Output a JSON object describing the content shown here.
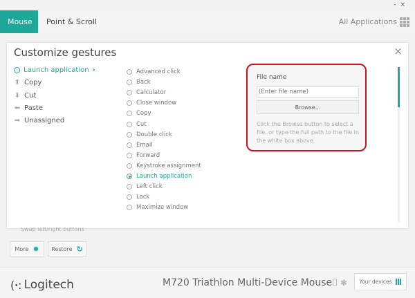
{
  "window": {
    "minimize": "-",
    "close": "×"
  },
  "tabs": [
    {
      "label": "Mouse",
      "active": true
    },
    {
      "label": "Point & Scroll"
    }
  ],
  "all_apps": "All Applications",
  "panel": {
    "title": "Customize gestures",
    "close": "×",
    "gestures": [
      {
        "icon": "circle-icon",
        "glyph": "",
        "label": "Launch application",
        "active": true,
        "chevron": "›"
      },
      {
        "icon": "arrow-up-icon",
        "glyph": "⬆",
        "label": "Copy"
      },
      {
        "icon": "arrow-down-icon",
        "glyph": "⬇",
        "label": "Cut"
      },
      {
        "icon": "arrow-left-icon",
        "glyph": "⬅",
        "label": "Paste"
      },
      {
        "icon": "arrow-right-icon",
        "glyph": "➡",
        "label": "Unassigned"
      }
    ],
    "options": [
      "Advanced click",
      "Back",
      "Calculator",
      "Close window",
      "Copy",
      "Cut",
      "Double click",
      "Email",
      "Forward",
      "Keystroke assignment",
      "Launch application",
      "Left click",
      "Lock",
      "Maximize window"
    ],
    "selected_option": "Launch application",
    "file": {
      "label": "File name",
      "placeholder": "(Enter file name)",
      "browse": "Browse...",
      "help": "Click the Browse button to select a file, or type the full path to the file in the white box above."
    }
  },
  "swap_label": "Swap left/right buttons",
  "buttons": {
    "more": "More",
    "restore": "Restore"
  },
  "footer": {
    "brand": "Logitech",
    "device": "M720 Triathlon Multi-Device Mouse",
    "your_devices": "Your devices"
  },
  "colors": {
    "accent": "#1fa89a",
    "highlight": "#c4161c"
  }
}
